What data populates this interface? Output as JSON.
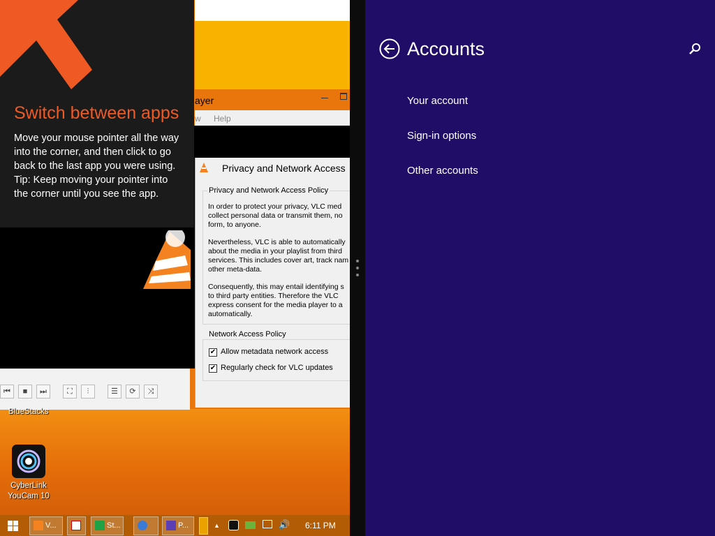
{
  "tip": {
    "title": "Switch between apps",
    "body_line1": "Move your mouse pointer all the way into the corner, and then click to go back to the last app you were using.",
    "body_line2": "Tip: Keep moving your pointer into the corner until you see the app."
  },
  "vlc": {
    "title_partial": "ayer",
    "menu_view_partial": "w",
    "menu_help": "Help"
  },
  "dialog": {
    "title": "Privacy and Network Access",
    "group1_label": "Privacy and Network Access Policy",
    "para1": "In order to protect your privacy, VLC med\ncollect personal data or transmit them, no\nform, to anyone.",
    "para2": "Nevertheless, VLC is able to automatically\nabout the media in your playlist from third\nservices. This includes cover art, track nam\nother meta-data.",
    "para3": "Consequently, this may entail identifying s\nto third party entities. Therefore the VLC\nexpress consent for the media player to a\nautomatically.",
    "group2_label": "Network Access Policy",
    "checkbox1_label": "Allow metadata network access",
    "checkbox1_checked": true,
    "checkbox2_label": "Regularly check for VLC updates",
    "checkbox2_checked": true
  },
  "desktop": {
    "icon1_label": "BlueStacks",
    "icon2_label_line1": "CyberLink",
    "icon2_label_line2": "YouCam 10"
  },
  "taskbar": {
    "items": [
      {
        "label": "V...",
        "icon": "vlc-icon"
      },
      {
        "label": "",
        "icon": "app-u-icon"
      },
      {
        "label": "St...",
        "icon": "store-icon"
      },
      {
        "label": "",
        "icon": "brightness-icon"
      },
      {
        "label": "P...",
        "icon": "settings-icon"
      }
    ],
    "clock": "6:11 PM",
    "tray_icons": [
      "show-hidden-icons-icon",
      "app-tray-icon",
      "bluestacks-tray-icon",
      "network-icon",
      "volume-icon"
    ]
  },
  "settings": {
    "title": "Accounts",
    "items": [
      "Your account",
      "Sign-in options",
      "Other accounts"
    ],
    "background_color": "#1f0d68"
  },
  "colors": {
    "tip_title": "#ef5a24",
    "desktop_orange": "#e8760c",
    "taskbar": "#b25d06"
  }
}
